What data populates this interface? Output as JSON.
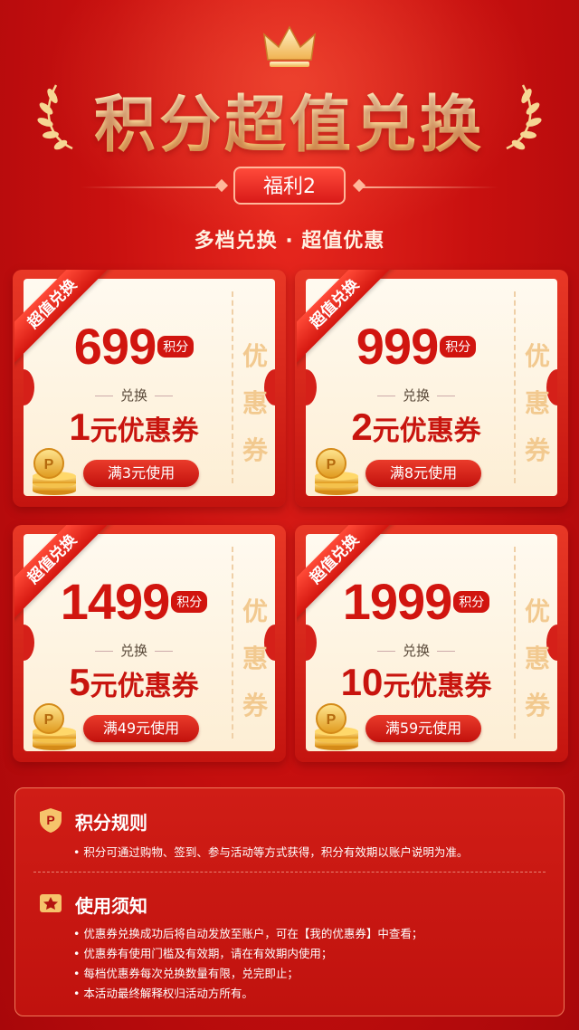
{
  "header": {
    "title": "积分超值兑换",
    "welfare_tag": "福利2",
    "subtitle": "多档兑换 · 超值优惠"
  },
  "cards": [
    {
      "ribbon": "超值兑换",
      "points": "699",
      "points_unit": "积分",
      "exchange": "兑换",
      "coupon_amount": "1",
      "coupon_suffix": "元优惠券",
      "condition": "满3元使用",
      "side_text": [
        "优",
        "惠",
        "券"
      ]
    },
    {
      "ribbon": "超值兑换",
      "points": "999",
      "points_unit": "积分",
      "exchange": "兑换",
      "coupon_amount": "2",
      "coupon_suffix": "元优惠券",
      "condition": "满8元使用",
      "side_text": [
        "优",
        "惠",
        "券"
      ]
    },
    {
      "ribbon": "超值兑换",
      "points": "1499",
      "points_unit": "积分",
      "exchange": "兑换",
      "coupon_amount": "5",
      "coupon_suffix": "元优惠券",
      "condition": "满49元使用",
      "side_text": [
        "优",
        "惠",
        "券"
      ]
    },
    {
      "ribbon": "超值兑换",
      "points": "1999",
      "points_unit": "积分",
      "exchange": "兑换",
      "coupon_amount": "10",
      "coupon_suffix": "元优惠券",
      "condition": "满59元使用",
      "side_text": [
        "优",
        "惠",
        "券"
      ]
    }
  ],
  "rules": {
    "points_rules_title": "积分规则",
    "points_rules": [
      "• 积分可通过购物、签到、参与活动等方式获得，积分有效期以账户说明为准。"
    ],
    "usage_title": "使用须知",
    "usage": [
      "• 优惠券兑换成功后将自动发放至账户，可在【我的优惠券】中查看；",
      "• 优惠券有使用门槛及有效期，请在有效期内使用；",
      "• 每档优惠券每次兑换数量有限，兑完即止；",
      "• 本活动最终解释权归活动方所有。"
    ]
  },
  "colors": {
    "primary_red": "#c8100f",
    "gold": "#ffe09a",
    "cream": "#fdeed4"
  },
  "icons": {
    "crown": "crown-icon",
    "laurel": "laurel-icon",
    "coins": "coin-stack-icon",
    "shield": "points-shield-icon",
    "badge": "star-badge-icon"
  }
}
